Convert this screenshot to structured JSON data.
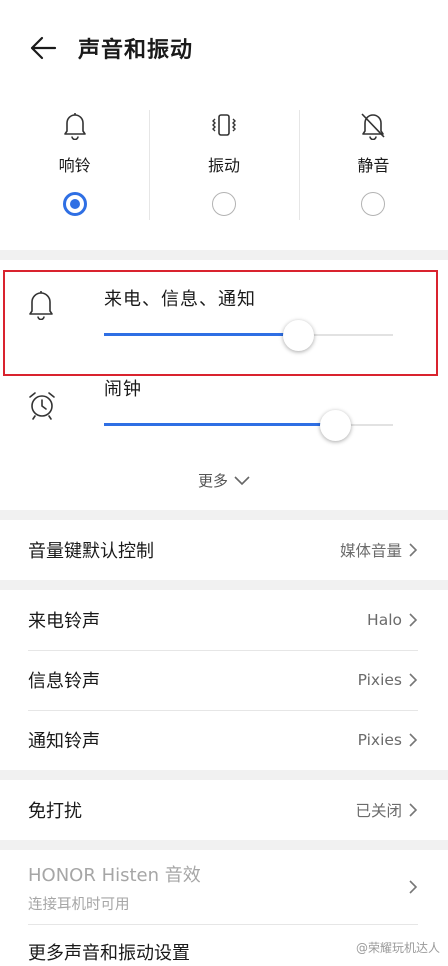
{
  "header": {
    "title": "声音和振动"
  },
  "modes": [
    {
      "label": "响铃",
      "icon": "bell-icon",
      "selected": true
    },
    {
      "label": "振动",
      "icon": "vibrate-icon",
      "selected": false
    },
    {
      "label": "静音",
      "icon": "bell-off-icon",
      "selected": false
    }
  ],
  "volume": {
    "ringtone": {
      "label": "来电、信息、通知",
      "icon": "bell-icon",
      "level": 0.67
    },
    "alarm": {
      "label": "闹钟",
      "icon": "alarm-clock-icon",
      "level": 0.8
    },
    "more_label": "更多"
  },
  "settings": {
    "volume_key": {
      "label": "音量键默认控制",
      "value": "媒体音量"
    },
    "incoming_ringtone": {
      "label": "来电铃声",
      "value": "Halo"
    },
    "message_ringtone": {
      "label": "信息铃声",
      "value": "Pixies"
    },
    "notification_ringtone": {
      "label": "通知铃声",
      "value": "Pixies"
    },
    "dnd": {
      "label": "免打扰",
      "value": "已关闭"
    },
    "histen": {
      "label": "HONOR Histen 音效",
      "sub": "连接耳机时可用"
    },
    "more_settings": {
      "label": "更多声音和振动设置"
    }
  },
  "watermark": "@荣耀玩机达人",
  "colors": {
    "accent": "#2f6fe4",
    "highlight": "#d9232e"
  }
}
